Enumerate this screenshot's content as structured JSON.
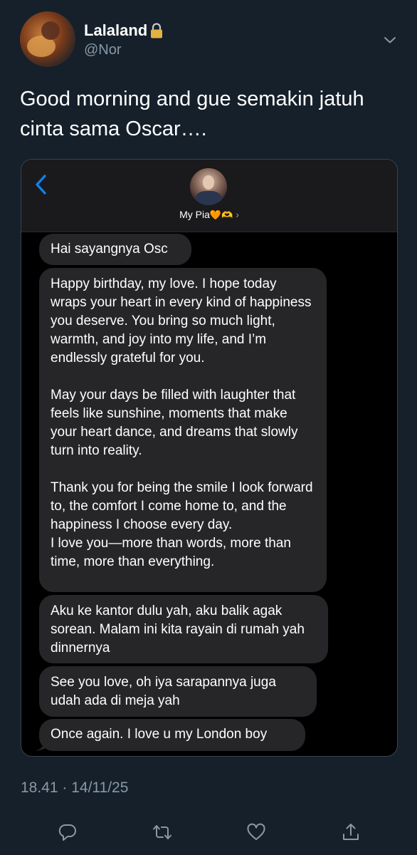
{
  "tweet": {
    "display_name": "Lalaland",
    "handle": "@Nor",
    "text": "Good morning and gue semakin jatuh cinta sama Oscar….",
    "timestamp": "18.41 · 14/11/25"
  },
  "screenshot": {
    "contact_name": "My Pia",
    "contact_emojis": "🧡🫶",
    "messages": [
      "Hai sayangnya Osc",
      "Happy birthday, my love. I hope today wraps your heart in every kind of happiness you deserve. You bring so much light, warmth, and joy into my life, and I’m endlessly grateful for you.\n\nMay your days be filled with laughter that feels like sunshine, moments that make your heart dance, and dreams that slowly turn into reality.\n\nThank you for being the smile I look forward to, the comfort I come home to, and the happiness I choose every day.\nI love you—more than words, more than time, more than everything.",
      "Aku ke kantor dulu yah, aku balik agak sorean. Malam ini kita rayain di rumah yah dinnernya",
      "See you love, oh iya sarapannya juga udah ada di meja yah",
      "Once again. I love u my London boy"
    ]
  },
  "icons": {
    "lock": "lock-icon",
    "more": "chevron-down-icon",
    "back": "chevron-left-icon",
    "reply": "reply-icon",
    "retweet": "retweet-icon",
    "like": "heart-icon",
    "share": "share-icon"
  },
  "colors": {
    "background": "#15202b",
    "secondary_text": "#8899a6",
    "bubble": "#262628",
    "ios_blue": "#0a84ff"
  }
}
